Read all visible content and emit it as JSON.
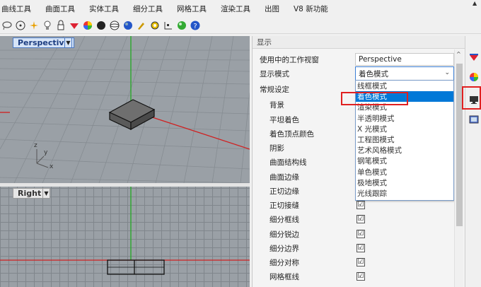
{
  "menu": [
    "曲线工具",
    "曲面工具",
    "实体工具",
    "细分工具",
    "网格工具",
    "渲染工具",
    "出图",
    "V8 新功能"
  ],
  "toolbar_icons": [
    "lasso-icon",
    "circle-dot-icon",
    "sparkle-icon",
    "bulb-icon",
    "lock-icon",
    "paint-icon",
    "color-wheel-icon",
    "dark-sphere-icon",
    "sphere-wire-icon",
    "blue-sphere-icon",
    "brush-icon",
    "gear-pattern-icon",
    "grid-snap-icon",
    "material-sphere-icon",
    "help-icon"
  ],
  "viewports": {
    "top": {
      "title": "Perspective"
    },
    "bottom": {
      "title": "Right"
    },
    "axis_y": "y",
    "axis_x": "x",
    "axis_z": "z"
  },
  "panel": {
    "header": "显示",
    "viewport_label": "使用中的工作视窗",
    "viewport_value": "Perspective",
    "mode_label": "显示模式",
    "mode_value": "着色模式",
    "general_label": "常规设定",
    "settings": [
      "背景",
      "平坦着色",
      "着色顶点颜色",
      "阴影",
      "曲面结构线",
      "曲面边缘",
      "正切边缘",
      "正切接缝",
      "细分框线",
      "细分锐边",
      "细分边界",
      "细分对称",
      "网格框线"
    ],
    "checked": [
      "正切接缝",
      "细分框线",
      "细分锐边",
      "细分边界",
      "细分对称",
      "网格框线"
    ],
    "check_mark": "☑",
    "dropdown_options": [
      "线框模式",
      "着色模式",
      "渲染模式",
      "半透明模式",
      "X 光模式",
      "工程图模式",
      "艺术风格模式",
      "钢笔模式",
      "单色模式",
      "极地模式",
      "光线跟踪"
    ],
    "dropdown_selected": "着色模式"
  },
  "side_icons": [
    "material-icon",
    "color-wheel-icon",
    "display-monitor-icon",
    "image-icon"
  ],
  "colors": {
    "accent": "#0078d7",
    "highlight": "#e02020",
    "viewport_bg": "#9aa0a6",
    "grid": "#80868c"
  }
}
